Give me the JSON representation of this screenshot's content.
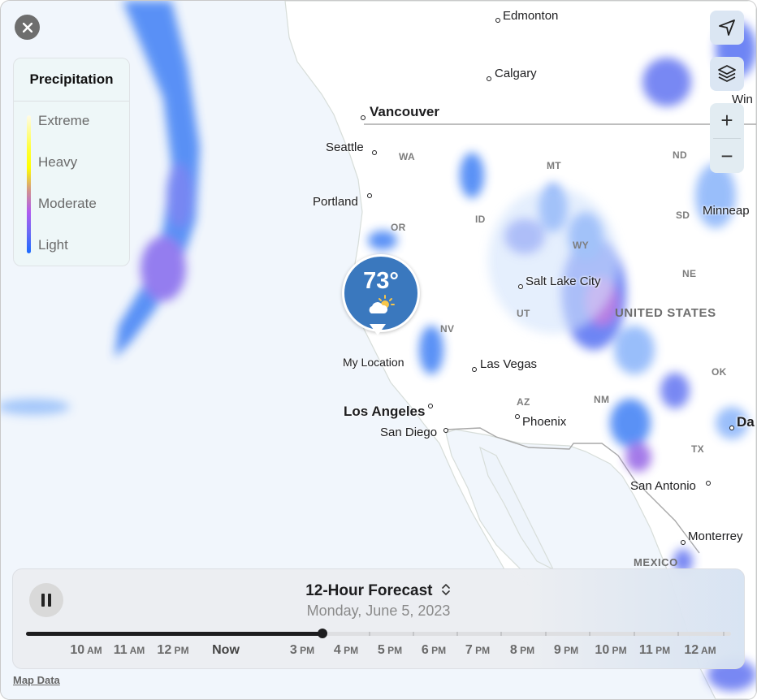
{
  "window": {
    "close_icon": "close-icon"
  },
  "legend": {
    "title": "Precipitation",
    "levels": [
      "Extreme",
      "Heavy",
      "Moderate",
      "Light"
    ],
    "colors": {
      "light": "#1b6bff",
      "moderate": "#b05cf0",
      "heavy": "#ffff00",
      "extreme": "#fffbe8"
    }
  },
  "controls": {
    "location_icon": "location-arrow-icon",
    "layers_icon": "layers-icon",
    "zoom_in": "+",
    "zoom_out": "−"
  },
  "map": {
    "cities": [
      {
        "name": "Edmonton"
      },
      {
        "name": "Calgary"
      },
      {
        "name": "Vancouver"
      },
      {
        "name": "Seattle"
      },
      {
        "name": "Portland"
      },
      {
        "name": "Salt Lake City"
      },
      {
        "name": "Las Vegas"
      },
      {
        "name": "Los Angeles"
      },
      {
        "name": "San Diego"
      },
      {
        "name": "Phoenix"
      },
      {
        "name": "San Antonio"
      },
      {
        "name": "Monterrey"
      },
      {
        "name": "Minneap"
      },
      {
        "name": "Win"
      },
      {
        "name": "Da"
      }
    ],
    "states": [
      "WA",
      "OR",
      "ID",
      "MT",
      "WY",
      "UT",
      "NV",
      "AZ",
      "NM",
      "ND",
      "SD",
      "NE",
      "OK",
      "TX"
    ],
    "countries": [
      "UNITED STATES",
      "MEXICO"
    ],
    "my_location": {
      "label": "My Location",
      "temperature": "73°",
      "condition_icon": "partly-sunny-icon"
    },
    "attribution": "Map Data"
  },
  "timeline": {
    "title": "12-Hour Forecast",
    "title_icon": "chevron-up-down-icon",
    "date": "Monday, June 5, 2023",
    "play_state": "playing",
    "progress": 0.42,
    "labels": [
      {
        "num": "10",
        "suffix": "AM"
      },
      {
        "num": "11",
        "suffix": "AM"
      },
      {
        "num": "12",
        "suffix": "PM"
      },
      {
        "num": "Now",
        "suffix": ""
      },
      {
        "num": "3",
        "suffix": "PM"
      },
      {
        "num": "4",
        "suffix": "PM"
      },
      {
        "num": "5",
        "suffix": "PM"
      },
      {
        "num": "6",
        "suffix": "PM"
      },
      {
        "num": "7",
        "suffix": "PM"
      },
      {
        "num": "8",
        "suffix": "PM"
      },
      {
        "num": "9",
        "suffix": "PM"
      },
      {
        "num": "10",
        "suffix": "PM"
      },
      {
        "num": "11",
        "suffix": "PM"
      },
      {
        "num": "12",
        "suffix": "AM"
      }
    ]
  }
}
